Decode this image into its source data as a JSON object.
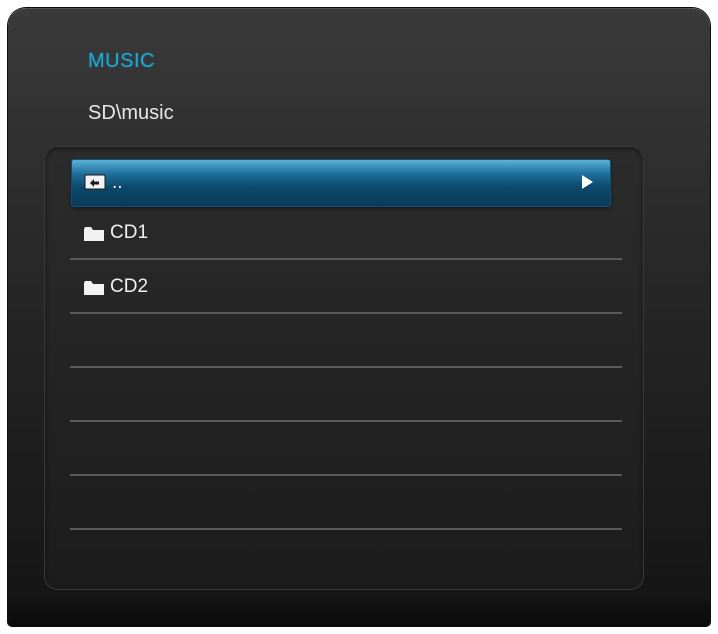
{
  "header": {
    "title": "MUSIC",
    "path": "SD\\music"
  },
  "list": {
    "items": [
      {
        "label": "..",
        "icon": "folder-up-icon",
        "selected": true
      },
      {
        "label": "CD1",
        "icon": "folder-icon",
        "selected": false
      },
      {
        "label": "CD2",
        "icon": "folder-icon",
        "selected": false
      },
      {
        "label": "",
        "icon": "",
        "selected": false
      },
      {
        "label": "",
        "icon": "",
        "selected": false
      },
      {
        "label": "",
        "icon": "",
        "selected": false
      },
      {
        "label": "",
        "icon": "",
        "selected": false
      },
      {
        "label": "",
        "icon": "",
        "selected": false
      }
    ]
  },
  "colors": {
    "title": "#1fa9d6",
    "selection": "#0c4769",
    "text": "#f0f0f0"
  }
}
